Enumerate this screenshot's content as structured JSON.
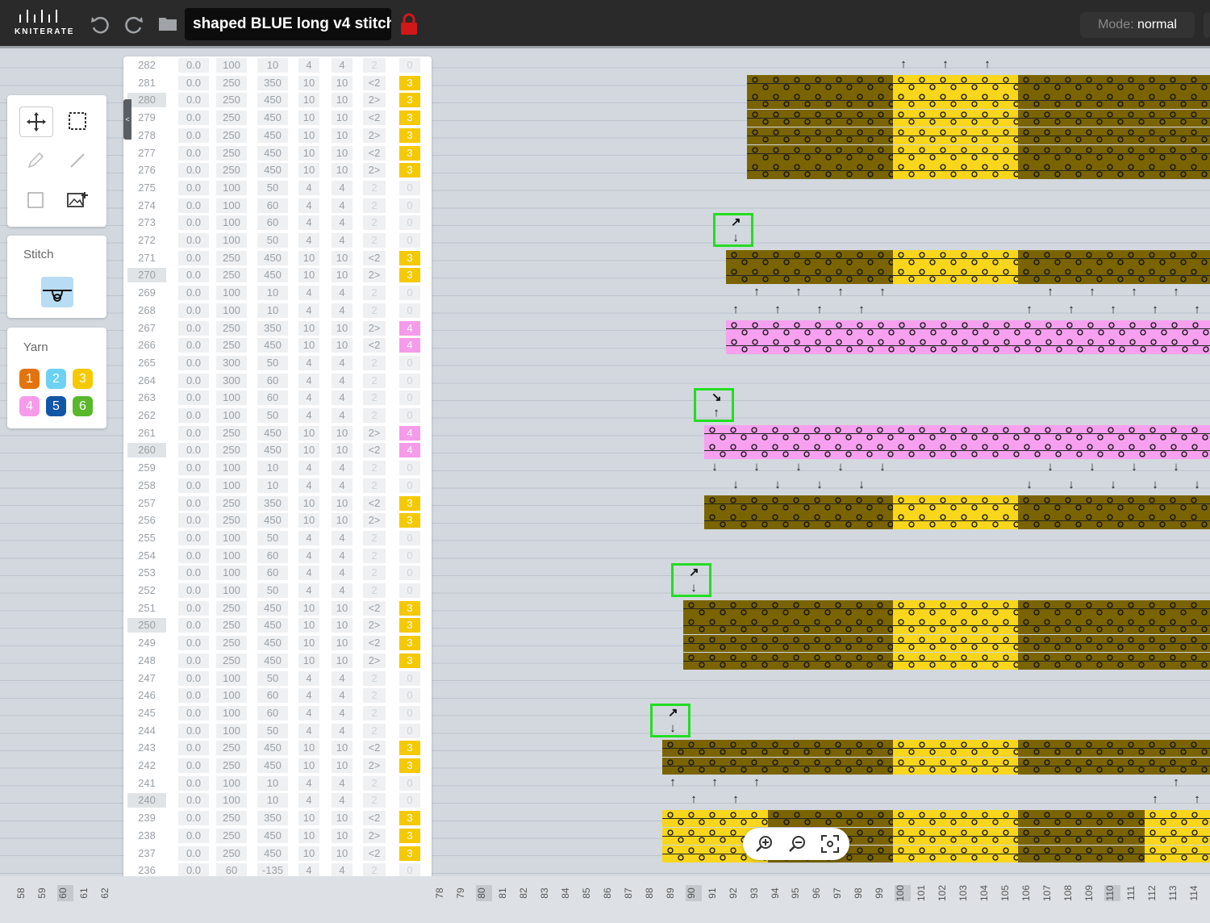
{
  "app": {
    "logo_text": "KNITERATE",
    "title": "shaped BLUE long v4 stitch",
    "mode_label": "Mode:",
    "mode_value": "normal"
  },
  "tools": {
    "stitch_title": "Stitch",
    "yarn_title": "Yarn",
    "yarns": [
      {
        "label": "1",
        "color": "#e2740e"
      },
      {
        "label": "2",
        "color": "#6cd1f2"
      },
      {
        "label": "3",
        "color": "#f5c900"
      },
      {
        "label": "4",
        "color": "#f59be9"
      },
      {
        "label": "5",
        "color": "#1256a6"
      },
      {
        "label": "6",
        "color": "#58b82a"
      }
    ]
  },
  "table": {
    "columns": [
      "Rack",
      "Speed",
      "Roll",
      "S/F",
      "S/R",
      "Dir",
      "Yarn"
    ],
    "rows": [
      {
        "n": "282",
        "rack": "0.0",
        "speed": "100",
        "roll": "10",
        "sf": "4",
        "sr": "4",
        "dir": "2",
        "yarn": "0"
      },
      {
        "n": "281",
        "rack": "0.0",
        "speed": "250",
        "roll": "350",
        "sf": "10",
        "sr": "10",
        "dir": "<2",
        "yarn": "3"
      },
      {
        "n": "280",
        "rack": "0.0",
        "speed": "250",
        "roll": "450",
        "sf": "10",
        "sr": "10",
        "dir": "2>",
        "yarn": "3"
      },
      {
        "n": "279",
        "rack": "0.0",
        "speed": "250",
        "roll": "450",
        "sf": "10",
        "sr": "10",
        "dir": "<2",
        "yarn": "3"
      },
      {
        "n": "278",
        "rack": "0.0",
        "speed": "250",
        "roll": "450",
        "sf": "10",
        "sr": "10",
        "dir": "2>",
        "yarn": "3"
      },
      {
        "n": "277",
        "rack": "0.0",
        "speed": "250",
        "roll": "450",
        "sf": "10",
        "sr": "10",
        "dir": "<2",
        "yarn": "3"
      },
      {
        "n": "276",
        "rack": "0.0",
        "speed": "250",
        "roll": "450",
        "sf": "10",
        "sr": "10",
        "dir": "2>",
        "yarn": "3"
      },
      {
        "n": "275",
        "rack": "0.0",
        "speed": "100",
        "roll": "50",
        "sf": "4",
        "sr": "4",
        "dir": "2",
        "yarn": "0"
      },
      {
        "n": "274",
        "rack": "0.0",
        "speed": "100",
        "roll": "60",
        "sf": "4",
        "sr": "4",
        "dir": "2",
        "yarn": "0"
      },
      {
        "n": "273",
        "rack": "0.0",
        "speed": "100",
        "roll": "60",
        "sf": "4",
        "sr": "4",
        "dir": "2",
        "yarn": "0"
      },
      {
        "n": "272",
        "rack": "0.0",
        "speed": "100",
        "roll": "50",
        "sf": "4",
        "sr": "4",
        "dir": "2",
        "yarn": "0"
      },
      {
        "n": "271",
        "rack": "0.0",
        "speed": "250",
        "roll": "450",
        "sf": "10",
        "sr": "10",
        "dir": "<2",
        "yarn": "3"
      },
      {
        "n": "270",
        "rack": "0.0",
        "speed": "250",
        "roll": "450",
        "sf": "10",
        "sr": "10",
        "dir": "2>",
        "yarn": "3"
      },
      {
        "n": "269",
        "rack": "0.0",
        "speed": "100",
        "roll": "10",
        "sf": "4",
        "sr": "4",
        "dir": "2",
        "yarn": "0"
      },
      {
        "n": "268",
        "rack": "0.0",
        "speed": "100",
        "roll": "10",
        "sf": "4",
        "sr": "4",
        "dir": "2",
        "yarn": "0"
      },
      {
        "n": "267",
        "rack": "0.0",
        "speed": "250",
        "roll": "350",
        "sf": "10",
        "sr": "10",
        "dir": "2>",
        "yarn": "4"
      },
      {
        "n": "266",
        "rack": "0.0",
        "speed": "250",
        "roll": "450",
        "sf": "10",
        "sr": "10",
        "dir": "<2",
        "yarn": "4"
      },
      {
        "n": "265",
        "rack": "0.0",
        "speed": "300",
        "roll": "50",
        "sf": "4",
        "sr": "4",
        "dir": "2",
        "yarn": "0"
      },
      {
        "n": "264",
        "rack": "0.0",
        "speed": "300",
        "roll": "60",
        "sf": "4",
        "sr": "4",
        "dir": "2",
        "yarn": "0"
      },
      {
        "n": "263",
        "rack": "0.0",
        "speed": "100",
        "roll": "60",
        "sf": "4",
        "sr": "4",
        "dir": "2",
        "yarn": "0"
      },
      {
        "n": "262",
        "rack": "0.0",
        "speed": "100",
        "roll": "50",
        "sf": "4",
        "sr": "4",
        "dir": "2",
        "yarn": "0"
      },
      {
        "n": "261",
        "rack": "0.0",
        "speed": "250",
        "roll": "450",
        "sf": "10",
        "sr": "10",
        "dir": "2>",
        "yarn": "4"
      },
      {
        "n": "260",
        "rack": "0.0",
        "speed": "250",
        "roll": "450",
        "sf": "10",
        "sr": "10",
        "dir": "<2",
        "yarn": "4"
      },
      {
        "n": "259",
        "rack": "0.0",
        "speed": "100",
        "roll": "10",
        "sf": "4",
        "sr": "4",
        "dir": "2",
        "yarn": "0"
      },
      {
        "n": "258",
        "rack": "0.0",
        "speed": "100",
        "roll": "10",
        "sf": "4",
        "sr": "4",
        "dir": "2",
        "yarn": "0"
      },
      {
        "n": "257",
        "rack": "0.0",
        "speed": "250",
        "roll": "350",
        "sf": "10",
        "sr": "10",
        "dir": "<2",
        "yarn": "3"
      },
      {
        "n": "256",
        "rack": "0.0",
        "speed": "250",
        "roll": "450",
        "sf": "10",
        "sr": "10",
        "dir": "2>",
        "yarn": "3"
      },
      {
        "n": "255",
        "rack": "0.0",
        "speed": "100",
        "roll": "50",
        "sf": "4",
        "sr": "4",
        "dir": "2",
        "yarn": "0"
      },
      {
        "n": "254",
        "rack": "0.0",
        "speed": "100",
        "roll": "60",
        "sf": "4",
        "sr": "4",
        "dir": "2",
        "yarn": "0"
      },
      {
        "n": "253",
        "rack": "0.0",
        "speed": "100",
        "roll": "60",
        "sf": "4",
        "sr": "4",
        "dir": "2",
        "yarn": "0"
      },
      {
        "n": "252",
        "rack": "0.0",
        "speed": "100",
        "roll": "50",
        "sf": "4",
        "sr": "4",
        "dir": "2",
        "yarn": "0"
      },
      {
        "n": "251",
        "rack": "0.0",
        "speed": "250",
        "roll": "450",
        "sf": "10",
        "sr": "10",
        "dir": "<2",
        "yarn": "3"
      },
      {
        "n": "250",
        "rack": "0.0",
        "speed": "250",
        "roll": "450",
        "sf": "10",
        "sr": "10",
        "dir": "2>",
        "yarn": "3"
      },
      {
        "n": "249",
        "rack": "0.0",
        "speed": "250",
        "roll": "450",
        "sf": "10",
        "sr": "10",
        "dir": "<2",
        "yarn": "3"
      },
      {
        "n": "248",
        "rack": "0.0",
        "speed": "250",
        "roll": "450",
        "sf": "10",
        "sr": "10",
        "dir": "2>",
        "yarn": "3"
      },
      {
        "n": "247",
        "rack": "0.0",
        "speed": "100",
        "roll": "50",
        "sf": "4",
        "sr": "4",
        "dir": "2",
        "yarn": "0"
      },
      {
        "n": "246",
        "rack": "0.0",
        "speed": "100",
        "roll": "60",
        "sf": "4",
        "sr": "4",
        "dir": "2",
        "yarn": "0"
      },
      {
        "n": "245",
        "rack": "0.0",
        "speed": "100",
        "roll": "60",
        "sf": "4",
        "sr": "4",
        "dir": "2",
        "yarn": "0"
      },
      {
        "n": "244",
        "rack": "0.0",
        "speed": "100",
        "roll": "50",
        "sf": "4",
        "sr": "4",
        "dir": "2",
        "yarn": "0"
      },
      {
        "n": "243",
        "rack": "0.0",
        "speed": "250",
        "roll": "450",
        "sf": "10",
        "sr": "10",
        "dir": "<2",
        "yarn": "3"
      },
      {
        "n": "242",
        "rack": "0.0",
        "speed": "250",
        "roll": "450",
        "sf": "10",
        "sr": "10",
        "dir": "2>",
        "yarn": "3"
      },
      {
        "n": "241",
        "rack": "0.0",
        "speed": "100",
        "roll": "10",
        "sf": "4",
        "sr": "4",
        "dir": "2",
        "yarn": "0"
      },
      {
        "n": "240",
        "rack": "0.0",
        "speed": "100",
        "roll": "10",
        "sf": "4",
        "sr": "4",
        "dir": "2",
        "yarn": "0"
      },
      {
        "n": "239",
        "rack": "0.0",
        "speed": "250",
        "roll": "350",
        "sf": "10",
        "sr": "10",
        "dir": "<2",
        "yarn": "3"
      },
      {
        "n": "238",
        "rack": "0.0",
        "speed": "250",
        "roll": "450",
        "sf": "10",
        "sr": "10",
        "dir": "2>",
        "yarn": "3"
      },
      {
        "n": "237",
        "rack": "0.0",
        "speed": "250",
        "roll": "450",
        "sf": "10",
        "sr": "10",
        "dir": "<2",
        "yarn": "3"
      },
      {
        "n": "236",
        "rack": "0.0",
        "speed": "60",
        "roll": "-135",
        "sf": "4",
        "sr": "4",
        "dir": "2",
        "yarn": "0"
      }
    ]
  },
  "ruler": {
    "left": [
      "58",
      "59",
      "60",
      "61",
      "62"
    ],
    "right": [
      "78",
      "79",
      "80",
      "81",
      "82",
      "83",
      "84",
      "85",
      "86",
      "87",
      "88",
      "89",
      "90",
      "91",
      "92",
      "93",
      "94",
      "95",
      "96",
      "97",
      "98",
      "99",
      "100",
      "101",
      "102",
      "103",
      "104",
      "105",
      "106",
      "107",
      "108",
      "109",
      "110",
      "111",
      "112",
      "113",
      "114"
    ]
  },
  "colors": {
    "olive": "#7a6400",
    "yellow": "#f7d61c",
    "pink": "#f6a0ef",
    "highlight_box": "#22dd22"
  }
}
